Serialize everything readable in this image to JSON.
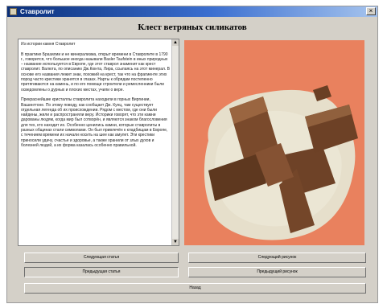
{
  "window": {
    "title": "Ставролит",
    "close_glyph": "×"
  },
  "heading": "Клест ветряных силикатов",
  "article": {
    "text": "Из истории камня Ставролит\n\nВ практике Бразилии и не минерализма, открыт времени в Ставролите в 1790 г., говорится, что большое иногда называли Basler Taufstein в иных природных – название используется в Европе, где этот ставрол знаменит как крест ставролит. Валюта, по описанию Дж.Кюнта, Лира, ссылаясь на этот минерал. В основе его названия лежит знак, похожий на крест, так что на фрагменте этих пород часто крестики хранятся в глазах. Нарты к обрядам постепенно притягиваются на камень, и по его помощи строители и ремесленники были осведомлены о дурных и плохих местах, учили о вере.\n\nПрекраснейшие кристаллы ставролита находили в горных Виргинии, Вашингтоне. По этому поводу, как сообщает Дж. Кунц, там существует отдельная легенда об их происхождении. Рядом с местом, где они были найдены, жили и распространяли веру. Историки говорят, что эти камни дарованы людям, когда мир был сотворён, и являются знаком благословения для тех, кто находит их. Особенно ценились камни, которые ставролиты в разных общинах стали символами. Он был привлечён к кладбищам в Европе, с течением времени их начали носить на шее как амулет. Эти крестики приносили удачу, счастье и здоровье, а также хранили от злых духов и болезней людей, а их форма казалась особенно правильной."
  },
  "photo": {
    "description_icon": "staurolite-cross-photo-icon",
    "background_color": "#e9815e",
    "matrix_color": "#e8e2cf",
    "crystal_color": "#7a4a2c"
  },
  "buttons": {
    "next_article": "Следующая статья",
    "prev_article": "Предыдущая статья",
    "next_photo": "Следующий рисунок",
    "prev_photo": "Предыдущий рисунок",
    "back": "Назад"
  }
}
